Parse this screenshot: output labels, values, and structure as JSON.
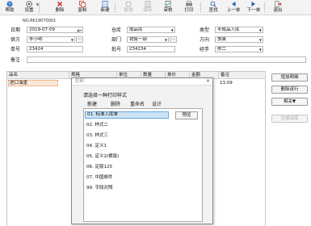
{
  "toolbar": {
    "help": "帮助",
    "settings": "设置",
    "delete": "删除",
    "copy": "复制",
    "new": "新建",
    "cancel": "取消",
    "save": "保存",
    "review": "审核",
    "print": "打印",
    "find": "查找",
    "prev": "上一单",
    "next": "下一单",
    "exit": "退出"
  },
  "form": {
    "doc_no": "NO.RK19070001",
    "date_label": "日期",
    "date_value": "2019-07-09",
    "supplier_label": "供方",
    "supplier_value": "李小明",
    "order_label": "单号",
    "order_value": "23424",
    "remark_label": "备注",
    "remark_value": "",
    "warehouse_label": "仓库",
    "warehouse_value": "成品库",
    "dept_label": "部门",
    "dept_value": "销售一部",
    "batch_label": "批号",
    "batch_value": "234234",
    "type_label": "类型",
    "type_value": "半成品入库",
    "direction_label": "方向",
    "direction_value": "放装",
    "handler_label": "经手",
    "handler_value": "陈二",
    "ellipsis": "..."
  },
  "grid": {
    "columns": [
      "品名",
      "规格",
      "单位",
      "数量",
      "单价",
      "金额",
      "备注"
    ],
    "row1_name": "进口油墨",
    "row1_value": "13.09"
  },
  "side_buttons": {
    "add_detail": "增加明细",
    "delete_row": "删除该行",
    "related": "相关▼",
    "generate": "生成出库"
  },
  "dialog": {
    "title": "打印",
    "close": "×",
    "prompt": "请选择一种打印样式",
    "tools": [
      "新建",
      "删除",
      "重命名",
      "设计"
    ],
    "items": [
      "01. 标准入库单",
      "02. 样式二",
      "03. 样式三",
      "04. 定义1",
      "05. 定义2(横版)",
      "06. 定版125",
      "07. 中国邮件",
      "99. 字段对照"
    ],
    "selected_index": 0,
    "preview": "预览"
  }
}
